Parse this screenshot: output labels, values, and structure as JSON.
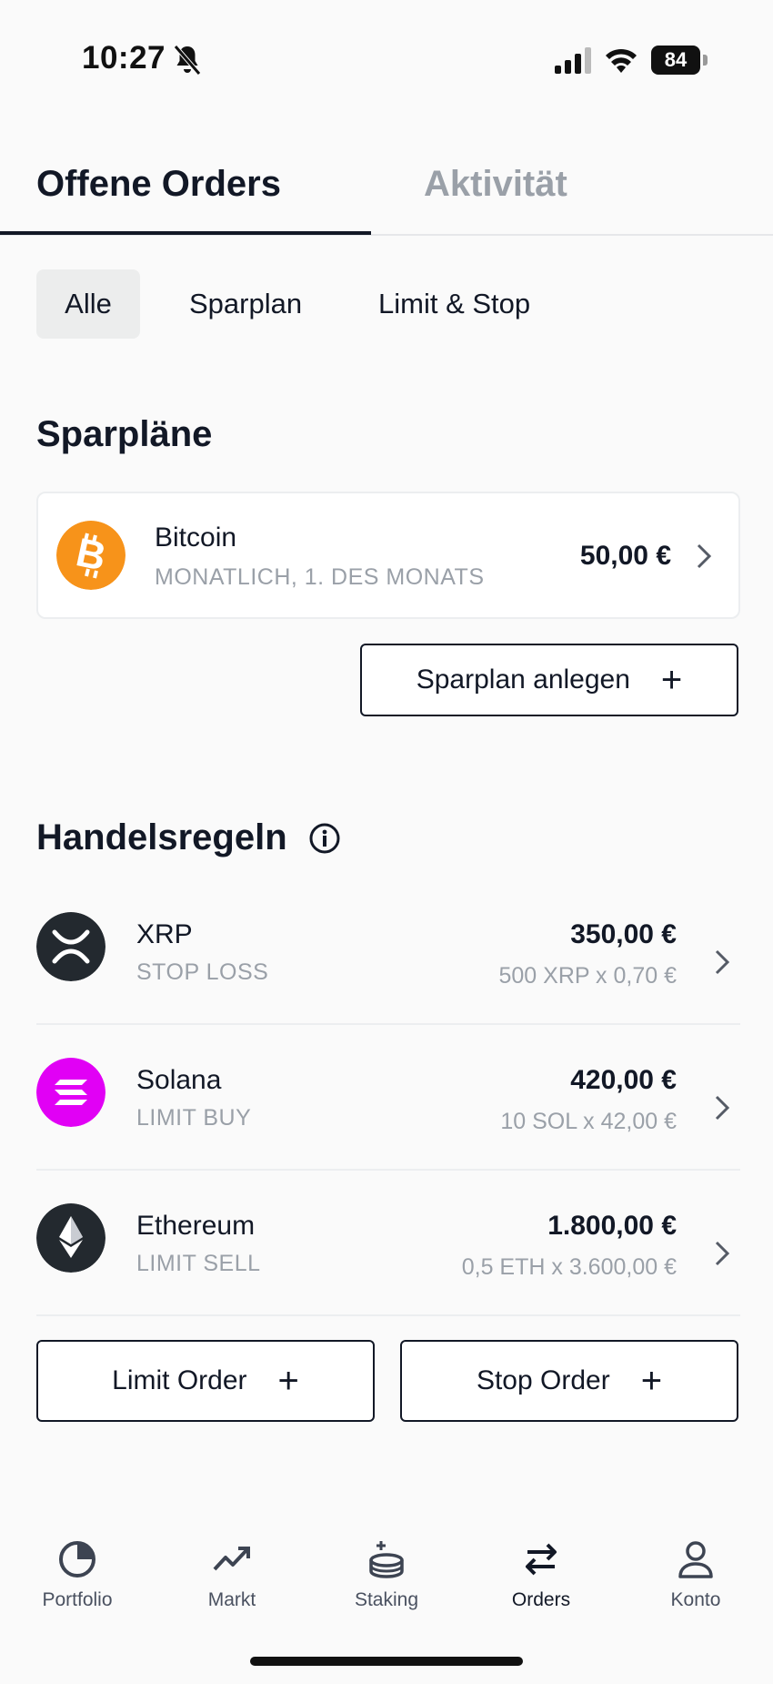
{
  "status_bar": {
    "time": "10:27",
    "battery": "84"
  },
  "tabs": [
    {
      "label": "Offene Orders",
      "active": true
    },
    {
      "label": "Aktivität",
      "active": false
    }
  ],
  "filters": [
    {
      "label": "Alle",
      "active": true
    },
    {
      "label": "Sparplan",
      "active": false
    },
    {
      "label": "Limit & Stop",
      "active": false
    }
  ],
  "sparplaene": {
    "title": "Sparpläne",
    "items": [
      {
        "name": "Bitcoin",
        "schedule": "MONATLICH, 1. DES MONATS",
        "amount": "50,00 €",
        "icon": "bitcoin-icon",
        "color": "#f7931a"
      }
    ],
    "add_label": "Sparplan anlegen"
  },
  "handelsregeln": {
    "title": "Handelsregeln",
    "items": [
      {
        "name": "XRP",
        "type": "STOP LOSS",
        "amount": "350,00 €",
        "detail": "500 XRP x 0,70 €",
        "icon": "xrp-icon",
        "color": "#23292f"
      },
      {
        "name": "Solana",
        "type": "LIMIT BUY",
        "amount": "420,00 €",
        "detail": "10 SOL x 42,00 €",
        "icon": "solana-icon",
        "color": "#e100f5"
      },
      {
        "name": "Ethereum",
        "type": "LIMIT SELL",
        "amount": "1.800,00 €",
        "detail": "0,5 ETH x 3.600,00 €",
        "icon": "ethereum-icon",
        "color": "#23292f"
      }
    ],
    "limit_order_label": "Limit Order",
    "stop_order_label": "Stop Order"
  },
  "bottom_nav": [
    {
      "label": "Portfolio",
      "icon": "portfolio-pie-icon"
    },
    {
      "label": "Markt",
      "icon": "trend-up-icon"
    },
    {
      "label": "Staking",
      "icon": "staking-coins-icon"
    },
    {
      "label": "Orders",
      "icon": "swap-arrows-icon",
      "active": true
    },
    {
      "label": "Konto",
      "icon": "user-icon"
    }
  ],
  "colors": {
    "text": "#121826",
    "muted": "#9aa0a8",
    "background": "#fafafa"
  }
}
